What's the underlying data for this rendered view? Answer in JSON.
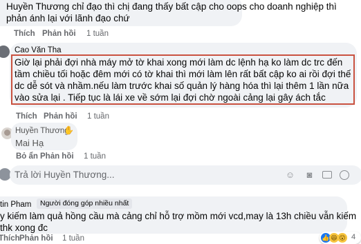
{
  "comment1": {
    "lines": [
      "Huyền Thương chỉ đạo thì chị đang thấy bất cập cho oops cho doanh nghiệp thì",
      "phản ánh lại với lãnh đạo chứ"
    ],
    "like": "Thích",
    "reply": "Phản hồi",
    "time": "1 tuần"
  },
  "comment2": {
    "author": "Cao Văn Tha",
    "lines": [
      "Giờ lại phải đợi nhà máy mở tờ khai xong mới làm dc lệnh hạ ko làm dc trc đến",
      "tầm chiều tối hoặc đêm mới có tờ khai thì mới làm lên rất bất cập ko ai rồi đợi thế",
      "dc dễ sót và nhầm.nếu làm trước khai số quản lý hàng hóa thì lại thêm 1 lần nữa",
      "vào sửa lại . Tiếp tục là lái xe về sớm lại đợi chờ ngoài cảng lại gây ách tắc"
    ],
    "like": "Thích",
    "reply": "Phản hồi",
    "time": "1 tuần"
  },
  "comment3": {
    "author": "Huyền Thương",
    "text": "Mai Hạ",
    "like": "Bỏ ẩn",
    "reply": "Phản hồi",
    "time": "1 tuần"
  },
  "reply_box": {
    "placeholder": "Trả lời Huyền Thương...",
    "icons": [
      "emoji-icon",
      "camera-icon",
      "gif-icon",
      "sticker-icon"
    ]
  },
  "comment4": {
    "author": "tin Pham",
    "badge": "Người đóng góp nhiều nhất",
    "lines": [
      "y kiếm làm quả hồng cầu mà cảng chỉ hỗ trợ mồm mới vcd,may là 13h chiều vẫn kiếm",
      "thk xong đc"
    ],
    "like": "Thích",
    "reply": "Phản hồi",
    "time": "1 tuần",
    "reaction_count": "4"
  },
  "colors": {
    "bubble": "#f0f2f5",
    "highlight_border": "#c9513f",
    "action_text": "#65676b"
  }
}
